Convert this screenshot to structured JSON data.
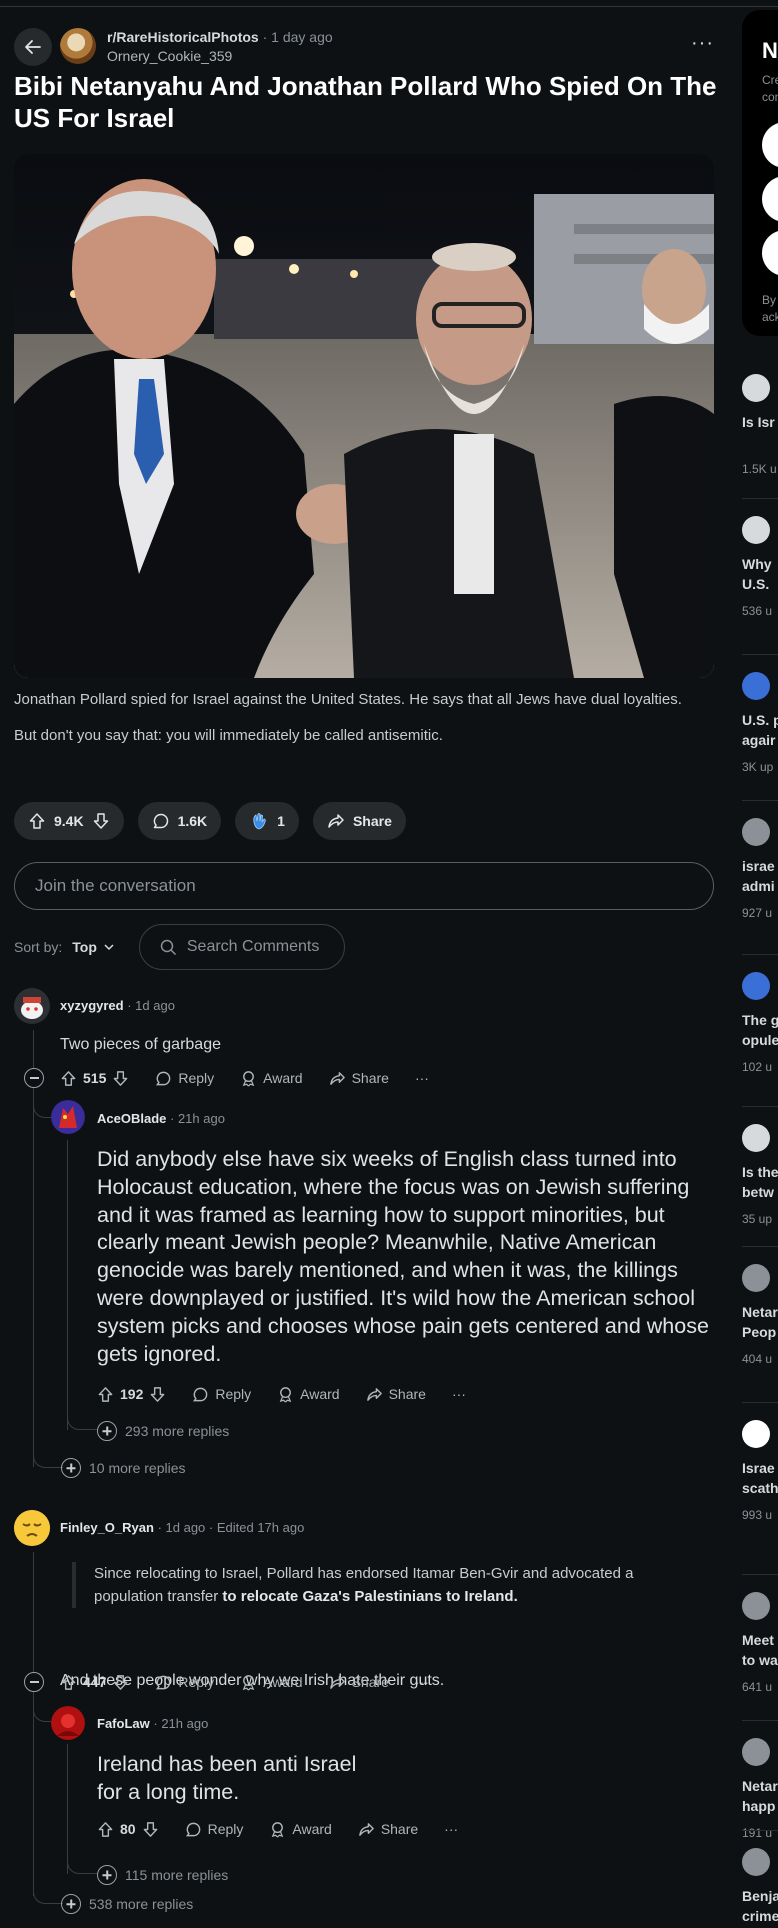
{
  "post": {
    "subreddit": "r/RareHistoricalPhotos",
    "time": "1 day ago",
    "author": "Ornery_Cookie_359",
    "title": "Bibi Netanyahu And Jonathan Pollard Who Spied On The US For Israel",
    "body": [
      "Jonathan Pollard spied for Israel against the United States. He says that all Jews have dual loyalties.",
      "But don't you say that: you will immediately be called antisemitic."
    ],
    "votes": "9.4K",
    "comments": "1.6K",
    "awards": "1",
    "share_label": "Share"
  },
  "join_placeholder": "Join the conversation",
  "sort": {
    "label": "Sort by:",
    "value": "Top",
    "search_placeholder": "Search Comments"
  },
  "comments": [
    {
      "user": "xyzygyred",
      "time": "1d ago",
      "text": "Two pieces of garbage",
      "votes": "515",
      "reply": {
        "user": "AceOBlade",
        "time": "21h ago",
        "text": "Did anybody else have six weeks of English class turned into Holocaust education, where the focus was on Jewish suffering and it was framed as learning how to support minorities, but clearly meant Jewish people? Meanwhile, Native American genocide was barely mentioned, and when it was, the killings were downplayed or justified. It's wild how the American school system picks and chooses whose pain gets centered and whose gets ignored.",
        "votes": "192",
        "more_replies": "293 more replies"
      },
      "more_replies": "10 more replies"
    },
    {
      "user": "Finley_O_Ryan",
      "time": "1d ago",
      "edited": "Edited 17h ago",
      "quote_plain": "Since relocating to Israel, Pollard has endorsed Itamar Ben-Gvir and advocated a population transfer",
      "quote_bold": "to relocate Gaza's Palestinians to Ireland.",
      "text": "And these people wonder why we Irish hate their guts.",
      "votes": "447",
      "reply": {
        "user": "FafoLaw",
        "time": "21h ago",
        "text_line1": "Ireland has been anti Israel",
        "text_line2": "for a long time.",
        "votes": "80",
        "more_replies": "115 more replies"
      },
      "more_replies": "538 more replies"
    }
  ],
  "comment_actions": {
    "reply": "Reply",
    "award": "Award",
    "share": "Share",
    "more": "···"
  },
  "sidebar": {
    "card_title": "Ne",
    "card_sub1": "Cre",
    "card_sub2": "con",
    "card_foot1": "By",
    "card_foot2": "ack",
    "items": [
      {
        "title1": "Is Isr",
        "title2": "",
        "upvotes": "1.5K u"
      },
      {
        "title1": "Why",
        "title2": "U.S. ",
        "upvotes": "536 u"
      },
      {
        "title1": "U.S. p",
        "title2": "agair",
        "upvotes": "3K up"
      },
      {
        "title1": "israe",
        "title2": "admi",
        "upvotes": "927 u"
      },
      {
        "title1": "The g",
        "title2": "opule",
        "upvotes": "102 u"
      },
      {
        "title1": "Is the",
        "title2": "betw",
        "upvotes": "35 up"
      },
      {
        "title1": "Netar",
        "title2": "Peop",
        "upvotes": "404 u"
      },
      {
        "title1": "Israe",
        "title2": "scath",
        "upvotes": "993 u"
      },
      {
        "title1": "Meet",
        "title2": "to wa",
        "upvotes": "641 u"
      },
      {
        "title1": "Netar",
        "title2": "happ",
        "upvotes": "191 u"
      },
      {
        "title1": "Benja",
        "title2": "crime",
        "upvotes": ""
      }
    ]
  }
}
